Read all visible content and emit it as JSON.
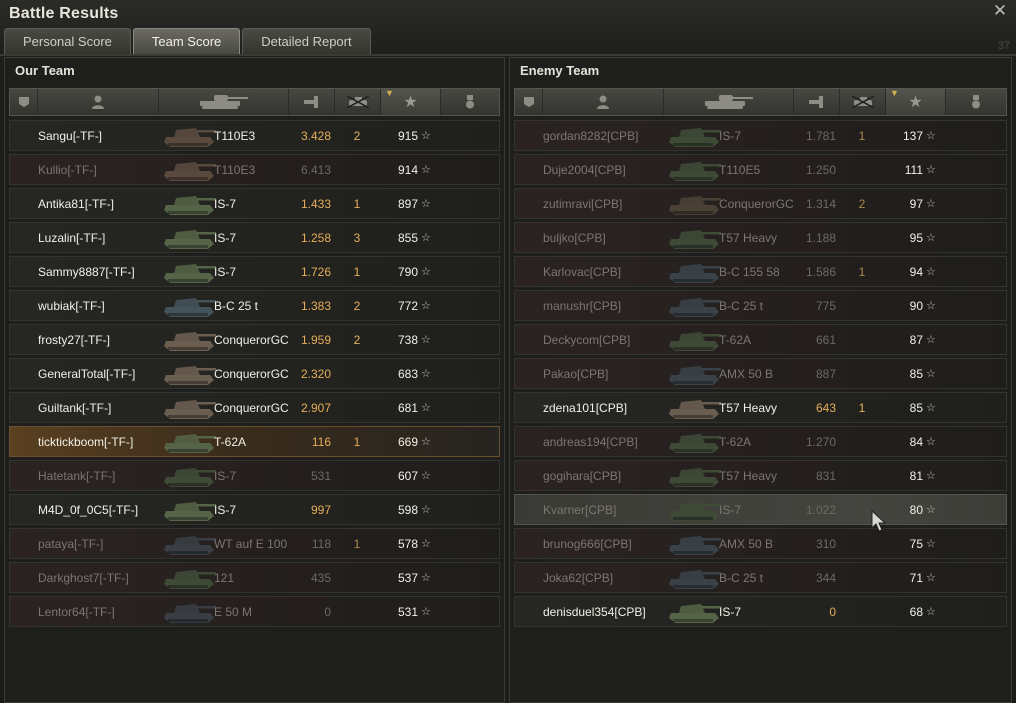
{
  "window": {
    "title": "Battle Results",
    "corner_number": "37"
  },
  "tabs": [
    {
      "label": "Personal Score",
      "active": false
    },
    {
      "label": "Team Score",
      "active": true
    },
    {
      "label": "Detailed Report",
      "active": false
    }
  ],
  "icons": {
    "close": "close-icon",
    "squad": "squad-icon",
    "player": "player-icon",
    "tank": "tank-icon",
    "damage": "damage-icon",
    "kills": "kills-icon",
    "xp": "star-icon",
    "medal": "medal-icon"
  },
  "colors": {
    "orange": "#e5ae5a",
    "self_highlight": "#5a4020",
    "text": "#f2f0e6",
    "dim_text": "#7c7670"
  },
  "our_team": {
    "title": "Our Team",
    "players": [
      {
        "name": "Sangu[-TF-]",
        "vehicle": "T110E3",
        "damage": "3.428",
        "kills": "2",
        "xp": "915",
        "alive": true,
        "tank_color": "#5a4a3e"
      },
      {
        "name": "Kullio[-TF-]",
        "vehicle": "T110E3",
        "damage": "6.413",
        "kills": "",
        "xp": "914",
        "alive": false,
        "tank_color": "#5a4a3e"
      },
      {
        "name": "Antika81[-TF-]",
        "vehicle": "IS-7",
        "damage": "1.433",
        "kills": "1",
        "xp": "897",
        "alive": true,
        "tank_color": "#556346"
      },
      {
        "name": "Luzalin[-TF-]",
        "vehicle": "IS-7",
        "damage": "1.258",
        "kills": "3",
        "xp": "855",
        "alive": true,
        "tank_color": "#556346"
      },
      {
        "name": "Sammy8887[-TF-]",
        "vehicle": "IS-7",
        "damage": "1.726",
        "kills": "1",
        "xp": "790",
        "alive": true,
        "tank_color": "#556346"
      },
      {
        "name": "wubiak[-TF-]",
        "vehicle": "B-C 25 t",
        "damage": "1.383",
        "kills": "2",
        "xp": "772",
        "alive": true,
        "tank_color": "#44525a"
      },
      {
        "name": "frosty27[-TF-]",
        "vehicle": "ConquerorGC",
        "damage": "1.959",
        "kills": "2",
        "xp": "738",
        "alive": true,
        "tank_color": "#6a5e50"
      },
      {
        "name": "GeneralTotal[-TF-]",
        "vehicle": "ConquerorGC",
        "damage": "2.320",
        "kills": "",
        "xp": "683",
        "alive": true,
        "tank_color": "#6a5e50"
      },
      {
        "name": "Guiltank[-TF-]",
        "vehicle": "ConquerorGC",
        "damage": "2.907",
        "kills": "",
        "xp": "681",
        "alive": true,
        "tank_color": "#6a5e50"
      },
      {
        "name": "ticktickboom[-TF-]",
        "vehicle": "T-62A",
        "damage": "116",
        "kills": "1",
        "xp": "669",
        "alive": true,
        "self": true,
        "tank_color": "#556346"
      },
      {
        "name": "Hatetank[-TF-]",
        "vehicle": "IS-7",
        "damage": "531",
        "kills": "",
        "xp": "607",
        "alive": false,
        "tank_color": "#3e4a36"
      },
      {
        "name": "M4D_0f_0C5[-TF-]",
        "vehicle": "IS-7",
        "damage": "997",
        "kills": "",
        "xp": "598",
        "alive": true,
        "tank_color": "#556346"
      },
      {
        "name": "pataya[-TF-]",
        "vehicle": "WT auf E 100",
        "damage": "118",
        "kills": "1",
        "xp": "578",
        "alive": false,
        "tank_color": "#3a3e44"
      },
      {
        "name": "Darkghost7[-TF-]",
        "vehicle": "121",
        "damage": "435",
        "kills": "",
        "xp": "537",
        "alive": false,
        "tank_color": "#3e4a36"
      },
      {
        "name": "Lentor64[-TF-]",
        "vehicle": "E 50 M",
        "damage": "0",
        "kills": "",
        "xp": "531",
        "alive": false,
        "tank_color": "#3a3e44"
      }
    ]
  },
  "enemy_team": {
    "title": "Enemy Team",
    "players": [
      {
        "name": "gordan8282[CPB]",
        "vehicle": "IS-7",
        "damage": "1.781",
        "kills": "1",
        "xp": "137",
        "alive": false,
        "tank_color": "#3e4a36"
      },
      {
        "name": "Duje2004[CPB]",
        "vehicle": "T110E5",
        "damage": "1.250",
        "kills": "",
        "xp": "111",
        "alive": false,
        "tank_color": "#3e4a36"
      },
      {
        "name": "zutimravi[CPB]",
        "vehicle": "ConquerorGC",
        "damage": "1.314",
        "kills": "2",
        "xp": "97",
        "alive": false,
        "tank_color": "#4a4036"
      },
      {
        "name": "buljko[CPB]",
        "vehicle": "T57 Heavy",
        "damage": "1.188",
        "kills": "",
        "xp": "95",
        "alive": false,
        "tank_color": "#3e4a36"
      },
      {
        "name": "Karlovac[CPB]",
        "vehicle": "B-C 155 58",
        "damage": "1.586",
        "kills": "1",
        "xp": "94",
        "alive": false,
        "tank_color": "#3a4248"
      },
      {
        "name": "manushr[CPB]",
        "vehicle": "B-C 25 t",
        "damage": "775",
        "kills": "",
        "xp": "90",
        "alive": false,
        "tank_color": "#3a4248"
      },
      {
        "name": "Deckycom[CPB]",
        "vehicle": "T-62A",
        "damage": "661",
        "kills": "",
        "xp": "87",
        "alive": false,
        "tank_color": "#3e4a36"
      },
      {
        "name": "Pakao[CPB]",
        "vehicle": "AMX 50 B",
        "damage": "887",
        "kills": "",
        "xp": "85",
        "alive": false,
        "tank_color": "#3a4248"
      },
      {
        "name": "zdena101[CPB]",
        "vehicle": "T57 Heavy",
        "damage": "643",
        "kills": "1",
        "xp": "85",
        "alive": true,
        "tank_color": "#6a5e50"
      },
      {
        "name": "andreas194[CPB]",
        "vehicle": "T-62A",
        "damage": "1.270",
        "kills": "",
        "xp": "84",
        "alive": false,
        "tank_color": "#3e4a36"
      },
      {
        "name": "gogihara[CPB]",
        "vehicle": "T57 Heavy",
        "damage": "831",
        "kills": "",
        "xp": "81",
        "alive": false,
        "tank_color": "#3e4a36"
      },
      {
        "name": "Kvarner[CPB]",
        "vehicle": "IS-7",
        "damage": "1.022",
        "kills": "",
        "xp": "80",
        "alive": false,
        "hover": true,
        "tank_color": "#3e4a36"
      },
      {
        "name": "brunog666[CPB]",
        "vehicle": "AMX 50 B",
        "damage": "310",
        "kills": "",
        "xp": "75",
        "alive": false,
        "tank_color": "#3a4248"
      },
      {
        "name": "Joka62[CPB]",
        "vehicle": "B-C 25 t",
        "damage": "344",
        "kills": "",
        "xp": "71",
        "alive": false,
        "tank_color": "#3a4248"
      },
      {
        "name": "denisduel354[CPB]",
        "vehicle": "IS-7",
        "damage": "0",
        "kills": "",
        "xp": "68",
        "alive": true,
        "tank_color": "#556346"
      }
    ]
  }
}
